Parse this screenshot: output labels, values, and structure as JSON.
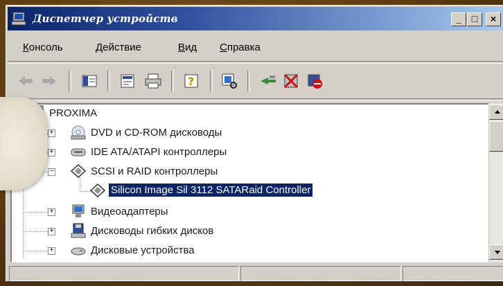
{
  "window": {
    "title": "Диспетчер устройств",
    "controls": {
      "minimize": "_",
      "maximize": "□",
      "close": "×"
    }
  },
  "menu": [
    {
      "label": "Консоль",
      "underline": "К",
      "rest": "онсоль"
    },
    {
      "label": "Действие",
      "underline": "Д",
      "rest": "ействие"
    },
    {
      "label": "Вид",
      "underline": "В",
      "rest": "ид"
    },
    {
      "label": "Справка",
      "underline": "С",
      "rest": "правка"
    }
  ],
  "toolbar": {
    "icons": [
      "back-icon",
      "forward-icon",
      "show-hide-console-tree-icon",
      "properties-icon",
      "print-icon",
      "help-icon",
      "scan-hardware-icon",
      "update-driver-icon",
      "uninstall-icon",
      "disable-icon"
    ]
  },
  "tree": {
    "root": "PROXIMA",
    "items": [
      {
        "label": "DVD и CD-ROM дисководы",
        "icon": "dvd-drive-icon",
        "expander": "+"
      },
      {
        "label": "IDE ATA/ATAPI контроллеры",
        "icon": "ide-controller-icon",
        "expander": "+"
      },
      {
        "label": "SCSI и RAID контроллеры",
        "icon": "scsi-controller-icon",
        "expander": "−"
      },
      {
        "label": "Silicon Image Sil 3112 SATARaid Controller",
        "icon": "scsi-device-icon",
        "selected": true
      },
      {
        "label": "Видеоадаптеры",
        "icon": "display-adapter-icon",
        "expander": "+"
      },
      {
        "label": "Дисководы гибких дисков",
        "icon": "floppy-drive-icon",
        "expander": "+"
      },
      {
        "label": "Дисковые устройства",
        "icon": "disk-drive-icon",
        "expander": "+"
      }
    ]
  },
  "colors": {
    "titlebar_start": "#0a246a",
    "titlebar_end": "#a6caf0",
    "selection": "#0a246a",
    "face": "#d4d0c8"
  }
}
